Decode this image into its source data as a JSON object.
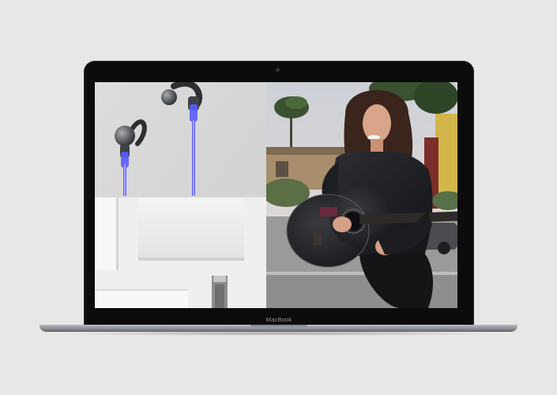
{
  "device": {
    "brand_label": "MacBook"
  },
  "screen": {
    "left_image": {
      "icon": "earphones-product-photo"
    },
    "right_image": {
      "icon": "woman-with-guitar-photo"
    }
  },
  "colors": {
    "background": "#e7e7e7",
    "bezel": "#0c0c0d",
    "led_blue": "#4a4cff"
  }
}
